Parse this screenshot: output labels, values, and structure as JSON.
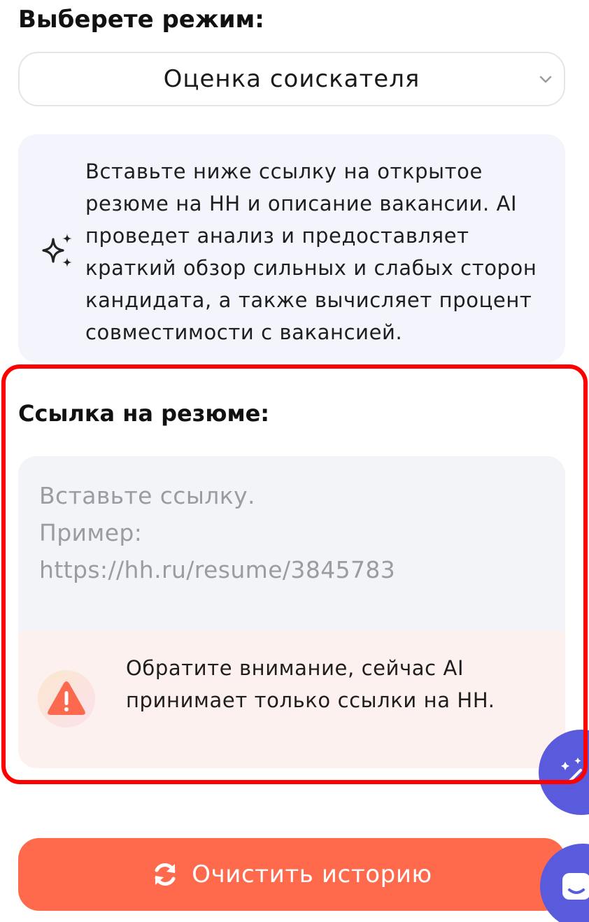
{
  "mode": {
    "label": "Выберете режим:",
    "selected": "Оценка соискателя"
  },
  "info": {
    "icon": "sparkle-icon",
    "text": "Вставьте ниже ссылку на открытое резюме на HH и описание вакансии. AI проведет анализ и предоставляет краткий обзор сильных и слабых сторон кандидата, а также вычисляет процент совместимости с вакансией."
  },
  "resume": {
    "label": "Ссылка на резюме:",
    "placeholder_line1": "Вставьте ссылку.",
    "placeholder_line2": "Пример:",
    "placeholder_line3": "https://hh.ru/resume/3845783"
  },
  "warning": {
    "icon": "warning-icon",
    "text": "Обратите внимание, сейчас AI принимает только ссылки на HH."
  },
  "actions": {
    "clear_label": "Очистить историю",
    "clear_icon": "refresh-icon"
  },
  "colors": {
    "accent": "#ff6a4d",
    "highlight": "#ff0000",
    "floating": "#5a5bdc",
    "info_bg": "#f4f5fc",
    "warning_bg": "#fdf1ef"
  }
}
